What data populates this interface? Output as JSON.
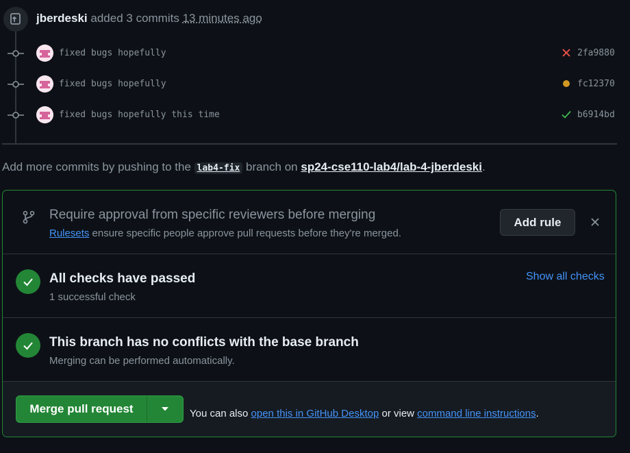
{
  "event": {
    "author": "jberdeski",
    "action": "added 3 commits",
    "time": "13 minutes ago"
  },
  "commits": [
    {
      "message": "fixed bugs hopefully",
      "sha": "2fa9880",
      "status": "failure",
      "status_color": "#f85149"
    },
    {
      "message": "fixed bugs hopefully",
      "sha": "fc12370",
      "status": "pending",
      "status_color": "#d29922"
    },
    {
      "message": "fixed bugs hopefully this time",
      "sha": "b6914bd",
      "status": "success",
      "status_color": "#3fb950"
    }
  ],
  "push_note": {
    "prefix": "Add more commits by pushing to the",
    "branch": "lab4-fix",
    "middle": "branch on",
    "repo": "sp24-cse110-lab4/lab-4-jberdeski",
    "suffix": "."
  },
  "rule_prompt": {
    "title": "Require approval from specific reviewers before merging",
    "link": "Rulesets",
    "text": "ensure specific people approve pull requests before they're merged.",
    "button": "Add rule"
  },
  "checks": {
    "title": "All checks have passed",
    "subtitle": "1 successful check",
    "link": "Show all checks"
  },
  "conflicts": {
    "title": "This branch has no conflicts with the base branch",
    "subtitle": "Merging can be performed automatically."
  },
  "merge": {
    "button": "Merge pull request",
    "note_prefix": "You can also",
    "desktop_link": "open this in GitHub Desktop",
    "note_middle": "or view",
    "cli_link": "command line instructions",
    "note_suffix": "."
  },
  "colors": {
    "accent_green": "#238636",
    "link_blue": "#4493f8",
    "background": "#0d1117"
  }
}
